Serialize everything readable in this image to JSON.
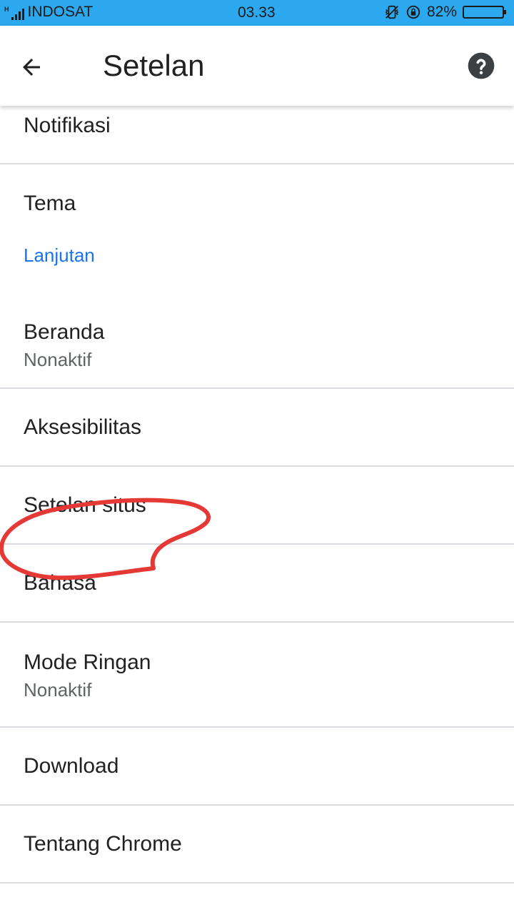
{
  "status_bar": {
    "network_type": "H",
    "carrier": "INDOSAT",
    "time": "03.33",
    "battery_percent_text": "82%",
    "battery_level": 0.82,
    "icons": [
      "signal-icon",
      "vibrate-icon",
      "rotation-lock-icon",
      "battery-icon"
    ]
  },
  "app_bar": {
    "back_icon": "arrow-back-icon",
    "title": "Setelan",
    "help_icon": "help-icon"
  },
  "settings": {
    "notifications": "Notifikasi",
    "theme": "Tema",
    "advanced_header": "Lanjutan",
    "homepage": {
      "label": "Beranda",
      "sub": "Nonaktif"
    },
    "accessibility": "Aksesibilitas",
    "site_settings": "Setelan situs",
    "languages": "Bahasa",
    "lite_mode": {
      "label": "Mode Ringan",
      "sub": "Nonaktif"
    },
    "downloads": "Download",
    "about_chrome": "Tentang Chrome"
  },
  "colors": {
    "status_bar": "#2ba8ee",
    "accent": "#1a73e8",
    "annotation": "#e53935"
  }
}
